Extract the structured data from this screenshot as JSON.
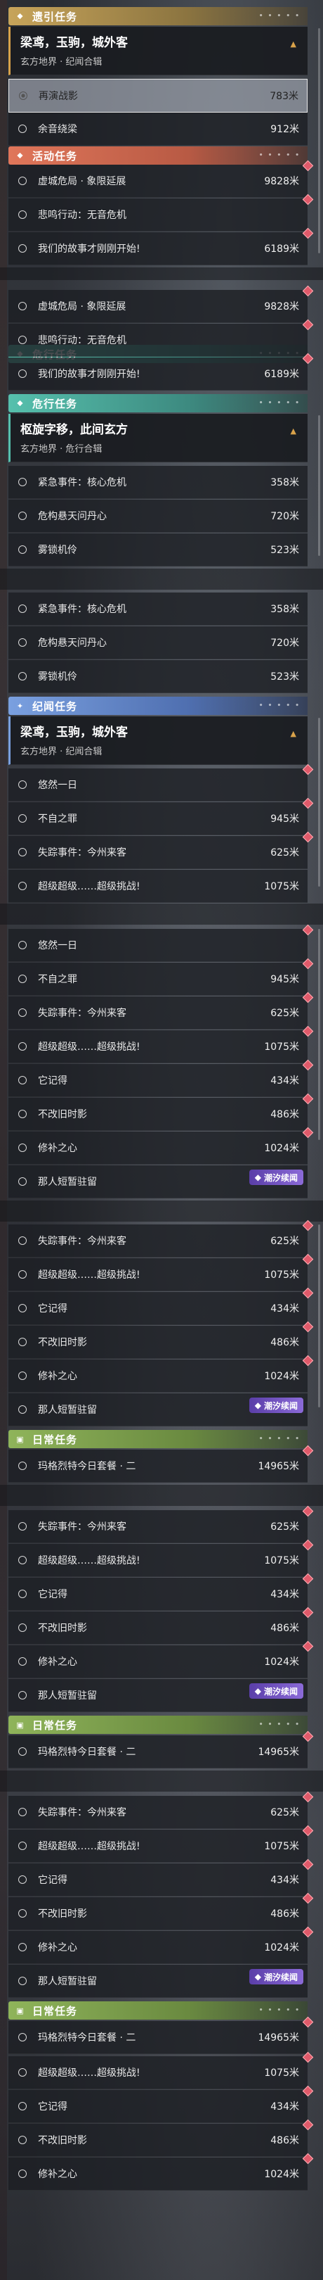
{
  "cats": {
    "guide": "遗引任务",
    "event": "活动任务",
    "danger": "危行任务",
    "chronicle": "纪闻任务",
    "daily": "日常任务"
  },
  "guide_head": {
    "title": "梁鸢，玉驹，城外客",
    "sub": "玄方地界 · 纪闻合辑"
  },
  "danger_head": {
    "title": "枢旋字移，此间玄方",
    "sub": "玄方地界 · 危行合辑"
  },
  "chron_head": {
    "title": "梁鸢，玉驹，城外客",
    "sub": "玄方地界 · 纪闻合辑"
  },
  "guide_rows": [
    {
      "name": "再演战影",
      "dist": "783米"
    },
    {
      "name": "余音绕梁",
      "dist": "912米"
    }
  ],
  "event_rows": [
    {
      "name": "虚城危局 · 象限延展",
      "dist": "9828米"
    },
    {
      "name": "悲鸣行动：无音危机",
      "dist": ""
    },
    {
      "name": "我们的故事才刚刚开始!",
      "dist": "6189米"
    }
  ],
  "danger_rows": [
    {
      "name": "紧急事件：核心危机",
      "dist": "358米"
    },
    {
      "name": "危构悬天问丹心",
      "dist": "720米"
    },
    {
      "name": "雾锁机伶",
      "dist": "523米"
    }
  ],
  "chron_rows": [
    {
      "name": "悠然一日",
      "dist": ""
    },
    {
      "name": "不自之罪",
      "dist": "945米"
    },
    {
      "name": "失踪事件：今州来客",
      "dist": "625米"
    },
    {
      "name": "超级超级……超级挑战!",
      "dist": "1075米"
    },
    {
      "name": "它记得",
      "dist": "434米"
    },
    {
      "name": "不改旧时影",
      "dist": "486米"
    },
    {
      "name": "修补之心",
      "dist": "1024米"
    },
    {
      "name": "那人短暂驻留",
      "dist": ""
    }
  ],
  "daily_rows": [
    {
      "name": "玛格烈特今日套餐 · 二",
      "dist": "14965米"
    }
  ],
  "badge": "潮汐续闻"
}
